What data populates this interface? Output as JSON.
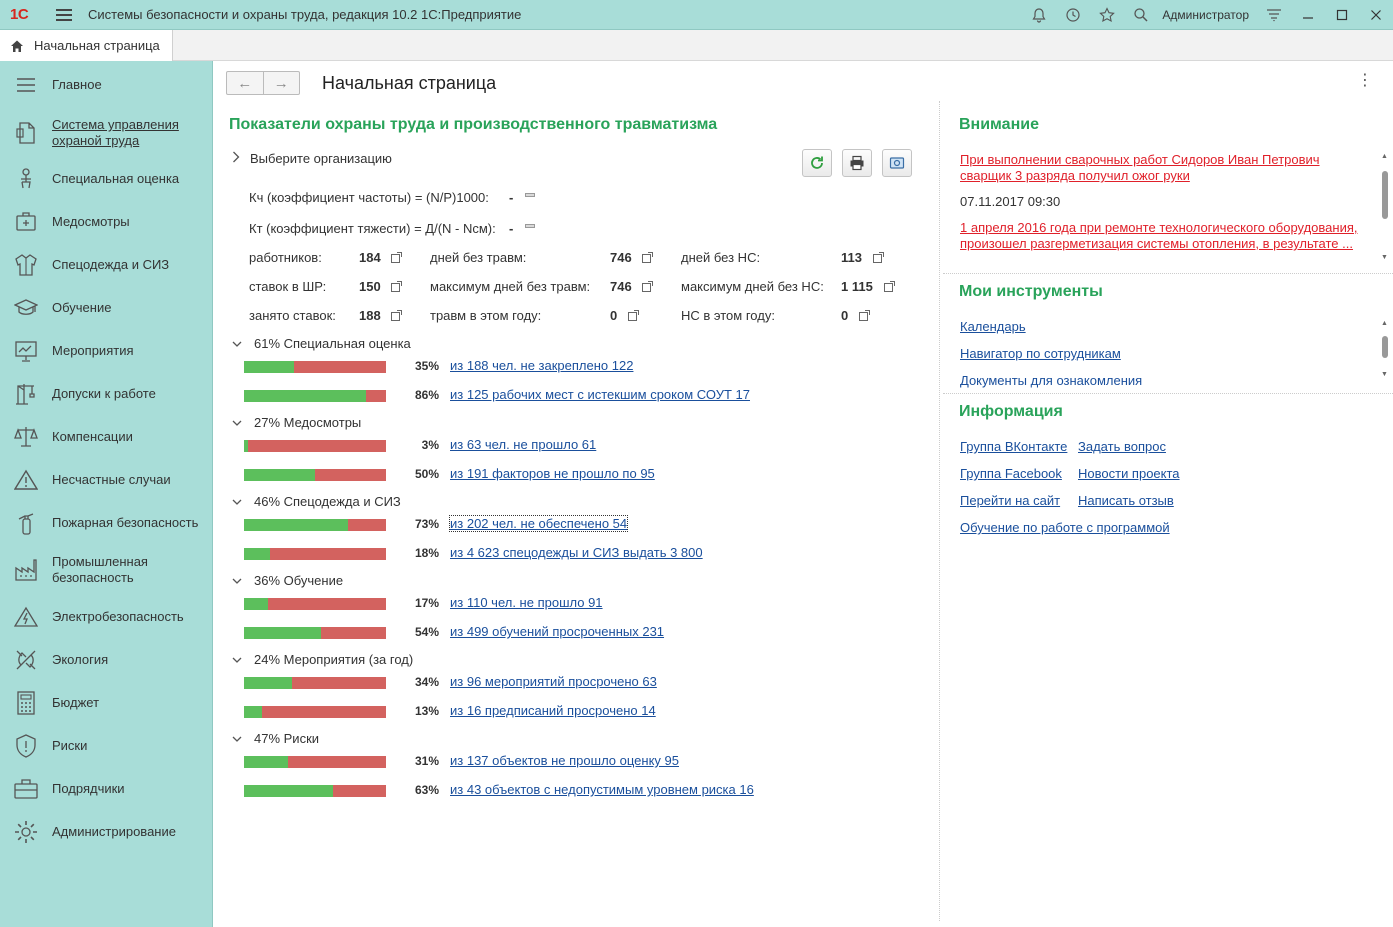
{
  "titlebar": {
    "logo": "1С",
    "title": "Системы безопасности и охраны труда, редакция 10.2 1С:Предприятие",
    "user": "Администратор"
  },
  "tabbar": {
    "home_tab": "Начальная страница"
  },
  "sidebar": {
    "items": [
      {
        "label": "Главное",
        "icon": "menu-lines-icon"
      },
      {
        "label": "Система управления охраной труда",
        "icon": "document-icon"
      },
      {
        "label": "Специальная оценка",
        "icon": "worker-chair-icon"
      },
      {
        "label": "Медосмотры",
        "icon": "medical-case-icon"
      },
      {
        "label": "Спецодежда и СИЗ",
        "icon": "jacket-icon"
      },
      {
        "label": "Обучение",
        "icon": "graduation-cap-icon"
      },
      {
        "label": "Мероприятия",
        "icon": "presentation-icon"
      },
      {
        "label": "Допуски к работе",
        "icon": "crane-icon"
      },
      {
        "label": "Компенсации",
        "icon": "scales-icon"
      },
      {
        "label": "Несчастные случаи",
        "icon": "warning-icon"
      },
      {
        "label": "Пожарная безопасность",
        "icon": "fire-extinguisher-icon"
      },
      {
        "label": "Промышленная безопасность",
        "icon": "factory-icon"
      },
      {
        "label": "Электробезопасность",
        "icon": "electric-hazard-icon"
      },
      {
        "label": "Экология",
        "icon": "nature-icon"
      },
      {
        "label": "Бюджет",
        "icon": "calculator-icon"
      },
      {
        "label": "Риски",
        "icon": "shield-icon"
      },
      {
        "label": "Подрядчики",
        "icon": "briefcase-icon"
      },
      {
        "label": "Администрирование",
        "icon": "gear-icon"
      }
    ]
  },
  "main": {
    "page_title": "Начальная страница",
    "section_title": "Показатели охраны труда и производственного травматизма",
    "select_org": "Выберите организацию",
    "kch_label": "Кч (коэффициент частоты) = (N/P)1000:",
    "kch_value": "-",
    "kt_label": "Кт (коэффициент тяжести) = Д/(N - Nсм):",
    "kt_value": "-",
    "stats": [
      {
        "label": "работников:",
        "value": "184"
      },
      {
        "label": "ставок в ШР:",
        "value": "150"
      },
      {
        "label": "занято ставок:",
        "value": "188"
      },
      {
        "label": "дней без травм:",
        "value": "746"
      },
      {
        "label": "максимум дней без травм:",
        "value": "746"
      },
      {
        "label": "травм в этом году:",
        "value": "0"
      },
      {
        "label": "дней без НС:",
        "value": "113"
      },
      {
        "label": "максимум дней без НС:",
        "value": "1 115"
      },
      {
        "label": "НС в этом году:",
        "value": "0"
      }
    ],
    "groups": [
      {
        "title": "61% Специальная оценка",
        "rows": [
          {
            "pct": "35%",
            "fill": 0.35,
            "link": "из 188 чел. не закреплено 122"
          },
          {
            "pct": "86%",
            "fill": 0.86,
            "link": "из 125 рабочих мест с истекшим сроком СОУТ 17"
          }
        ]
      },
      {
        "title": "27% Медосмотры",
        "rows": [
          {
            "pct": "3%",
            "fill": 0.03,
            "link": "из 63 чел. не прошло 61"
          },
          {
            "pct": "50%",
            "fill": 0.5,
            "link": "из 191 факторов не прошло по 95"
          }
        ]
      },
      {
        "title": "46% Спецодежда и СИЗ",
        "rows": [
          {
            "pct": "73%",
            "fill": 0.73,
            "link": "из 202 чел. не обеспечено 54"
          },
          {
            "pct": "18%",
            "fill": 0.18,
            "link": "из 4 623 спецодежды и СИЗ выдать 3 800"
          }
        ]
      },
      {
        "title": "36% Обучение",
        "rows": [
          {
            "pct": "17%",
            "fill": 0.17,
            "link": "из 110 чел. не прошло 91"
          },
          {
            "pct": "54%",
            "fill": 0.54,
            "link": "из 499 обучений просроченных 231"
          }
        ]
      },
      {
        "title": "24% Мероприятия (за год)",
        "rows": [
          {
            "pct": "34%",
            "fill": 0.34,
            "link": "из 96 мероприятий просрочено 63"
          },
          {
            "pct": "13%",
            "fill": 0.13,
            "link": "из 16 предписаний просрочено 14"
          }
        ]
      },
      {
        "title": "47% Риски",
        "rows": [
          {
            "pct": "31%",
            "fill": 0.31,
            "link": "из 137 объектов не прошло оценку 95"
          },
          {
            "pct": "63%",
            "fill": 0.63,
            "link": "из 43 объектов с недопустимым уровнем риска 16"
          }
        ]
      }
    ]
  },
  "right": {
    "attention_title": "Внимание",
    "alert1": "При выполнении сварочных работ Сидоров Иван Петрович сварщик 3 разряда получил ожог руки",
    "alert1_date": "07.11.2017 09:30",
    "alert2": "1 апреля 2016 года при ремонте технологического оборудования, произошел разгерметизация системы отопления, в результате ...",
    "tools_title": "Мои инструменты",
    "tools": [
      "Календарь",
      "Навигатор по сотрудникам",
      "Документы для ознакомления"
    ],
    "info_title": "Информация",
    "info_links": [
      "Группа ВКонтакте",
      "Задать вопрос",
      "Группа Facebook",
      "Новости проекта",
      "Перейти на сайт",
      "Написать отзыв",
      "Обучение по работе с программой"
    ]
  },
  "colors": {
    "accent_green": "#29a35a",
    "bar_green": "#5cbf5c",
    "bar_red": "#d3625f",
    "alert_red": "#e0202a",
    "sidebar_bg": "#a8ddd8"
  }
}
